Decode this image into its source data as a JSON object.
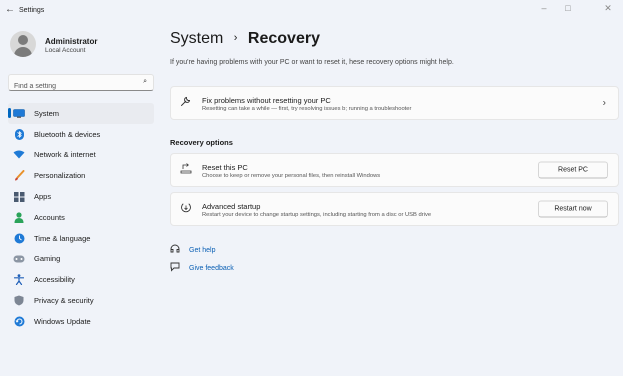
{
  "window": {
    "title": "Settings",
    "back_icon": "back-arrow-icon",
    "minimize": "–",
    "maximize": "□",
    "close": "✕"
  },
  "profile": {
    "name": "Administrator",
    "account_type": "Local Account"
  },
  "search": {
    "placeholder": "Find a setting",
    "icon": "search-icon"
  },
  "sidebar": {
    "items": [
      {
        "label": "System",
        "icon": "system-icon",
        "active": true
      },
      {
        "label": "Bluetooth & devices",
        "icon": "bluetooth-icon"
      },
      {
        "label": "Network & internet",
        "icon": "network-icon"
      },
      {
        "label": "Personalization",
        "icon": "personalization-icon"
      },
      {
        "label": "Apps",
        "icon": "apps-icon"
      },
      {
        "label": "Accounts",
        "icon": "accounts-icon"
      },
      {
        "label": "Time & language",
        "icon": "time-language-icon"
      },
      {
        "label": "Gaming",
        "icon": "gaming-icon"
      },
      {
        "label": "Accessibility",
        "icon": "accessibility-icon"
      },
      {
        "label": "Privacy & security",
        "icon": "privacy-icon"
      },
      {
        "label": "Windows Update",
        "icon": "windows-update-icon"
      }
    ]
  },
  "main": {
    "breadcrumb_parent": "System",
    "breadcrumb_separator": "›",
    "breadcrumb_current": "Recovery",
    "subtitle": "If you're having problems with your PC or want to reset it, hese recovery options might help.",
    "fix_problems": {
      "title": "Fix problems without resetting your PC",
      "description": "Resetting can take a while — first, try resolving issues b; running a troubleshooter",
      "icon": "wrench-icon"
    },
    "recovery_options_label": "Recovery options",
    "reset_pc": {
      "title": "Reset this PC",
      "description": "Choose to keep or remove your personal files, then reinstall Windows",
      "button": "Reset PC",
      "icon": "reset-pc-icon"
    },
    "advanced_startup": {
      "title": "Advanced startup",
      "description": "Restart your device to change startup settings, including starting from a disc or USB drive",
      "button": "Restart now",
      "icon": "advanced-startup-icon"
    },
    "links": {
      "get_help": "Get help",
      "give_feedback": "Give feedback"
    }
  },
  "colors": {
    "accent": "#0067c0",
    "link": "#0a5fb4",
    "background": "#f0f3f9",
    "card": "#fbfbfb"
  }
}
